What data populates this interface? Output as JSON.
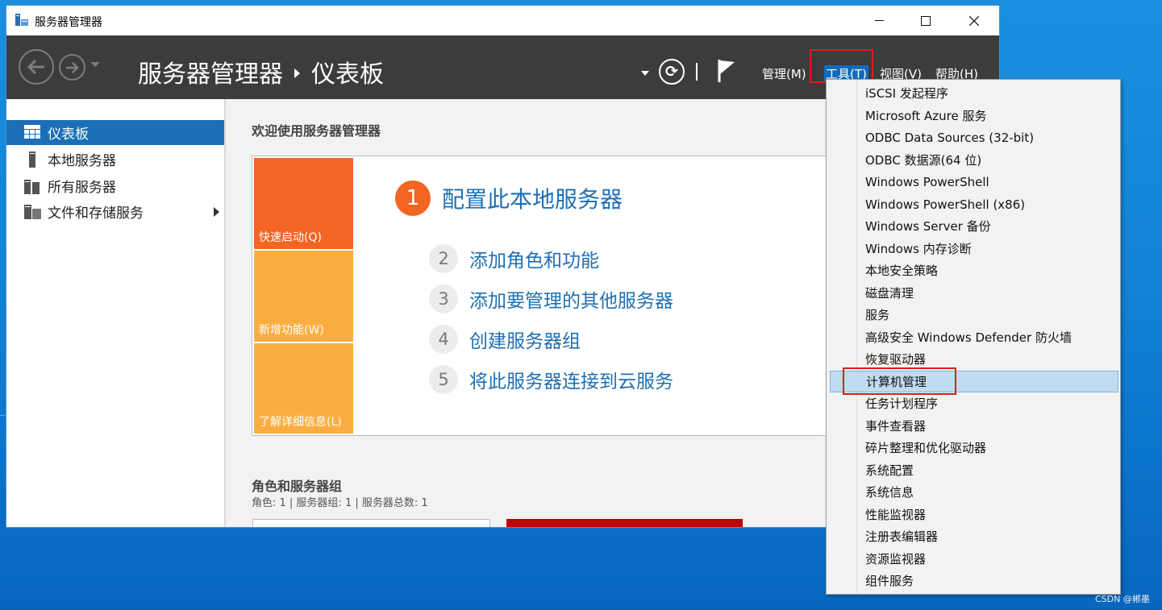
{
  "window": {
    "title": "服务器管理器"
  },
  "header": {
    "breadcrumb_root": "服务器管理器",
    "breadcrumb_page": "仪表板",
    "menu": [
      {
        "label": "管理(M)"
      },
      {
        "label": "工具(T)",
        "active": true
      },
      {
        "label": "视图(V)"
      },
      {
        "label": "帮助(H)"
      }
    ]
  },
  "sidebar": {
    "items": [
      {
        "label": "仪表板",
        "icon": "dashboard-icon",
        "selected": true
      },
      {
        "label": "本地服务器",
        "icon": "server-icon"
      },
      {
        "label": "所有服务器",
        "icon": "servers-icon"
      },
      {
        "label": "文件和存储服务",
        "icon": "storage-icon",
        "has_submenu": true
      }
    ]
  },
  "main": {
    "welcome_title": "欢迎使用服务器管理器",
    "tiles": [
      {
        "label": "快速启动(Q)",
        "color": "#f26522"
      },
      {
        "label": "新增功能(W)",
        "color": "#fbae40"
      },
      {
        "label": "了解详细信息(L)",
        "color": "#fbae40"
      }
    ],
    "steps": [
      {
        "num": "1",
        "text": "配置此本地服务器"
      },
      {
        "num": "2",
        "text": "添加角色和功能"
      },
      {
        "num": "3",
        "text": "添加要管理的其他服务器"
      },
      {
        "num": "4",
        "text": "创建服务器组"
      },
      {
        "num": "5",
        "text": "将此服务器连接到云服务"
      }
    ],
    "roles_title": "角色和服务器组",
    "roles_summary": "角色: 1 | 服务器组: 1 | 服务器总数: 1"
  },
  "tools_menu": {
    "items": [
      "iSCSI 发起程序",
      "Microsoft Azure 服务",
      "ODBC Data Sources (32-bit)",
      "ODBC 数据源(64 位)",
      "Windows PowerShell",
      "Windows PowerShell (x86)",
      "Windows Server 备份",
      "Windows 内存诊断",
      "本地安全策略",
      "磁盘清理",
      "服务",
      "高级安全 Windows Defender 防火墙",
      "恢复驱动器",
      "计算机管理",
      "任务计划程序",
      "事件查看器",
      "碎片整理和优化驱动器",
      "系统配置",
      "系统信息",
      "性能监视器",
      "注册表编辑器",
      "资源监视器",
      "组件服务"
    ],
    "highlighted": "计算机管理"
  },
  "watermark": "CSDN @郴墨",
  "colors": {
    "accent": "#1a6fb6",
    "header_bg": "#3c3c3c",
    "link": "#1e6fb3",
    "highlight_box": "#e01b1b"
  }
}
